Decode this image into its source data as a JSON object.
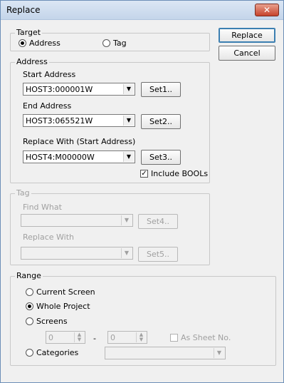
{
  "window": {
    "title": "Replace",
    "close_label": "✕"
  },
  "buttons": {
    "replace": "Replace",
    "cancel": "Cancel"
  },
  "target": {
    "legend": "Target",
    "address_label": "Address",
    "tag_label": "Tag",
    "selected": "address"
  },
  "address": {
    "legend": "Address",
    "start_label": "Start Address",
    "start_value": "HOST3:000001W",
    "set1": "Set1..",
    "end_label": "End Address",
    "end_value": "HOST3:065521W",
    "set2": "Set2..",
    "replace_label": "Replace With (Start Address)",
    "replace_value": "HOST4:M00000W",
    "set3": "Set3..",
    "include_bools_label": "Include BOOLs",
    "include_bools_checked": true
  },
  "tag": {
    "legend": "Tag",
    "find_label": "Find What",
    "find_value": "",
    "set4": "Set4..",
    "replace_label": "Replace With",
    "replace_value": "",
    "set5": "Set5.."
  },
  "range": {
    "legend": "Range",
    "current_screen": "Current Screen",
    "whole_project": "Whole Project",
    "screens": "Screens",
    "categories": "Categories",
    "selected": "whole_project",
    "screen_from": "0",
    "screen_to": "0",
    "dash": "-",
    "as_sheet_no": "As Sheet No.",
    "category_value": ""
  }
}
